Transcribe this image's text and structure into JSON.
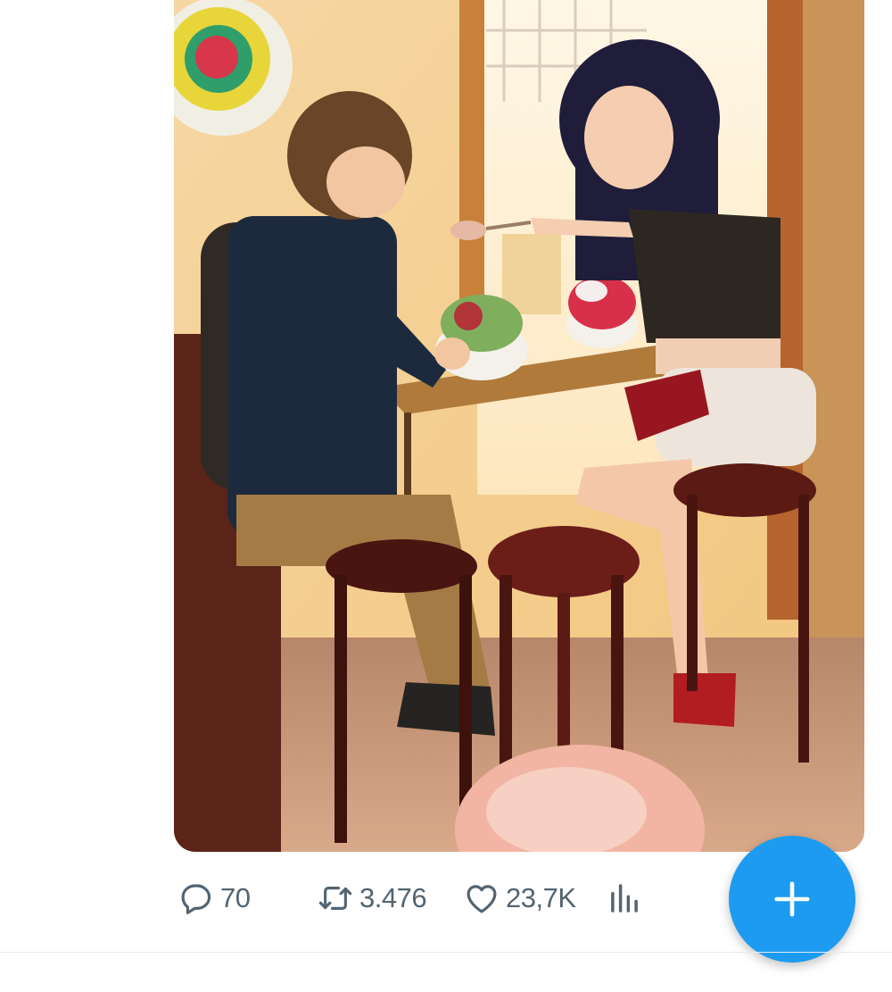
{
  "tweet": {
    "media": {
      "alt": "",
      "icon": "illustration-image"
    },
    "actions": {
      "reply": {
        "icon": "reply-icon",
        "count": "70"
      },
      "retweet": {
        "icon": "retweet-icon",
        "count": "3.476"
      },
      "like": {
        "icon": "heart-icon",
        "count": "23,7K"
      },
      "views": {
        "icon": "analytics-icon"
      }
    }
  },
  "fab": {
    "icon": "compose-plus-icon"
  },
  "colors": {
    "accent": "#1d9bf0",
    "action_gray": "#536471",
    "divider": "#e6ecf0"
  }
}
